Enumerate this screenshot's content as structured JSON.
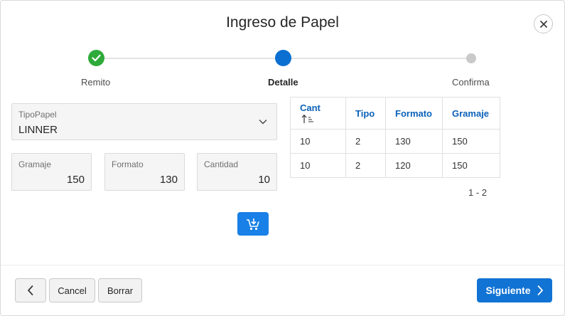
{
  "dialog": {
    "title": "Ingreso de Papel"
  },
  "stepper": {
    "steps": [
      {
        "label": "Remito",
        "state": "complete"
      },
      {
        "label": "Detalle",
        "state": "current"
      },
      {
        "label": "Confirma",
        "state": "pending"
      }
    ]
  },
  "form": {
    "tipo_papel": {
      "label": "TipoPapel",
      "value": "LINNER"
    },
    "gramaje": {
      "label": "Gramaje",
      "value": "150"
    },
    "formato": {
      "label": "Formato",
      "value": "130"
    },
    "cantidad": {
      "label": "Cantidad",
      "value": "10"
    }
  },
  "table": {
    "headers": [
      "Cant",
      "Tipo",
      "Formato",
      "Gramaje"
    ],
    "rows": [
      [
        "10",
        "2",
        "130",
        "150"
      ],
      [
        "10",
        "2",
        "120",
        "150"
      ]
    ],
    "pagination": "1 - 2"
  },
  "footer": {
    "cancel_label": "Cancel",
    "clear_label": "Borrar",
    "next_label": "Siguiente"
  },
  "colors": {
    "primary": "#1173d4",
    "step_complete": "#2eaa3a",
    "step_current": "#0b6fd1",
    "step_pending": "#c9c9c9",
    "header_text": "#0b61b8"
  },
  "icons": {
    "close": "close-icon",
    "check": "check-icon",
    "chevron": "chevron-down-icon",
    "add_to_cart": "cart-add-icon",
    "sort": "sort-ascending-icon",
    "back": "chevron-left-icon",
    "next": "chevron-right-icon"
  }
}
